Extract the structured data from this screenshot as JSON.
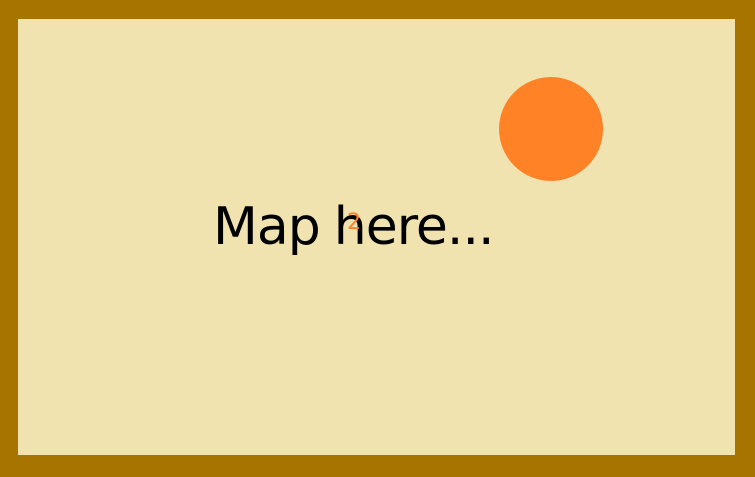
{
  "map": {
    "placeholder_word_1": "Map",
    "placeholder_word_2": "here...",
    "marker_label": "2"
  },
  "colors": {
    "frame": "#a87400",
    "canvas": "#f0e3b0",
    "marker": "#ff8227",
    "text": "#000000"
  },
  "icons": {
    "marker": "circle-marker-icon"
  }
}
